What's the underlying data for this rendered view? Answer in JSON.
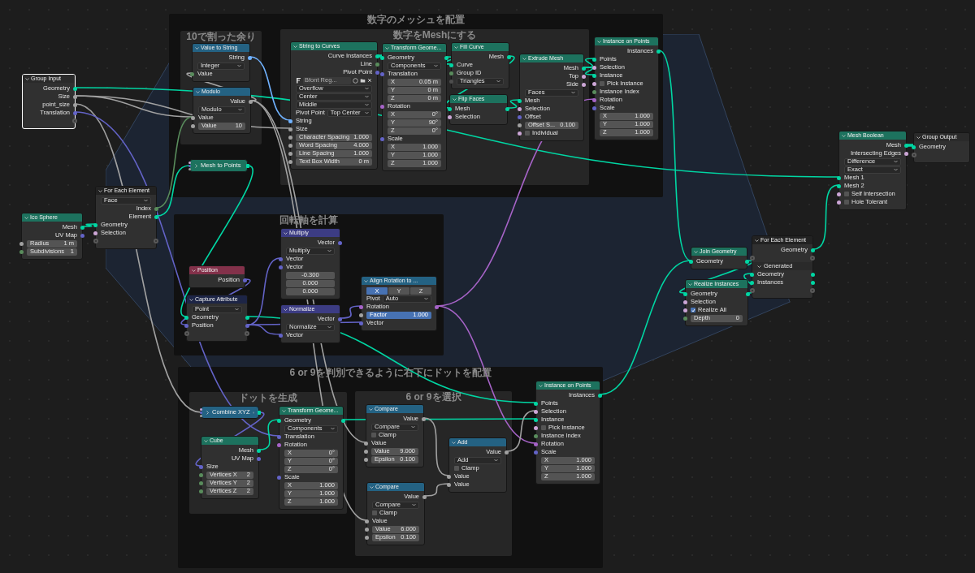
{
  "frames": [
    {
      "title": "数字のメッシュを配置",
      "color": "#111111"
    },
    {
      "title": "10で割った余り",
      "color": "#262626"
    },
    {
      "title": "数字をMeshにする",
      "color": "#262626"
    },
    {
      "title": "回転軸を計算",
      "color": "#111111"
    },
    {
      "title": "6 or 9を判別できるように右下にドットを配置",
      "color": "#111111"
    },
    {
      "title": "ドットを生成",
      "color": "#262626"
    },
    {
      "title": "6 or 9を選択",
      "color": "#262626"
    }
  ],
  "nodes": [
    {
      "title": "Group Input",
      "color": "#2a2a2a",
      "collapsed": false,
      "selected": true,
      "rows": [
        {
          "kind": "socket",
          "label": "Geometry",
          "out": {
            "color": "#00d6a3"
          }
        },
        {
          "kind": "socket",
          "label": "Size",
          "out": {
            "color": "#a1a1a1"
          }
        },
        {
          "kind": "socket",
          "label": "point_size",
          "out": {
            "color": "#a1a1a1"
          }
        },
        {
          "kind": "socket",
          "label": "Translation",
          "out": {
            "color": "#6363c7"
          }
        },
        {
          "kind": "socket",
          "out": {
            "color": "#5a5a5a",
            "hollow": true
          }
        }
      ]
    },
    {
      "title": "Value to String",
      "color": "#246283",
      "collapsed": false,
      "selected": false,
      "rows": [
        {
          "kind": "socket",
          "label": "String",
          "out": {
            "color": "#70b2ff"
          }
        },
        {
          "kind": "menu",
          "value": "Integer"
        },
        {
          "kind": "socket",
          "label": "Value",
          "in": {
            "color": "#598c5c"
          }
        }
      ]
    },
    {
      "title": "Modulo",
      "color": "#246283",
      "collapsed": false,
      "selected": false,
      "rows": [
        {
          "kind": "socket",
          "label": "Value",
          "out": {
            "color": "#a1a1a1"
          }
        },
        {
          "kind": "menu",
          "value": "Modulo"
        },
        {
          "kind": "socket",
          "label": "Value",
          "in": {
            "color": "#a1a1a1"
          }
        },
        {
          "kind": "field",
          "label": "Value",
          "value": "10",
          "in": {
            "color": "#a1a1a1"
          }
        }
      ]
    },
    {
      "title": "Mesh to Points",
      "color": "#1d725e",
      "collapsed": true,
      "selected": false
    },
    {
      "title": "For Each Element",
      "color": "#222222",
      "collapsed": false,
      "selected": false,
      "rows": [
        {
          "kind": "menu",
          "value": "Face"
        },
        {
          "kind": "socket",
          "label": "Index",
          "out": {
            "color": "#598c5c"
          }
        },
        {
          "kind": "socket",
          "label": "Element",
          "out": {
            "color": "#00d6a3"
          }
        },
        {
          "kind": "socket",
          "label": "Geometry",
          "in": {
            "color": "#00d6a3"
          }
        },
        {
          "kind": "socket",
          "label": "Selection",
          "in": {
            "color": "#cca6d6"
          }
        },
        {
          "kind": "socket",
          "in": {
            "color": "#5a5a5a",
            "hollow": true
          },
          "out": {
            "color": "#5a5a5a",
            "hollow": true
          }
        }
      ]
    },
    {
      "title": "Ico Sphere",
      "color": "#1d725e",
      "collapsed": false,
      "selected": false,
      "rows": [
        {
          "kind": "socket",
          "label": "Mesh",
          "out": {
            "color": "#00d6a3"
          }
        },
        {
          "kind": "socket",
          "label": "UV Map",
          "out": {
            "color": "#6363c7"
          }
        },
        {
          "kind": "field",
          "label": "Radius",
          "value": "1 m",
          "in": {
            "color": "#a1a1a1"
          }
        },
        {
          "kind": "field",
          "label": "Subdivisions",
          "value": "1",
          "in": {
            "color": "#598c5c"
          }
        }
      ]
    },
    {
      "title": "String to Curves",
      "color": "#1d725e",
      "collapsed": false,
      "selected": false,
      "rows": [
        {
          "kind": "socket",
          "label": "Curve Instances",
          "out": {
            "color": "#00d6a3"
          }
        },
        {
          "kind": "socket",
          "label": "Line",
          "out": {
            "color": "#598c5c"
          }
        },
        {
          "kind": "socket",
          "label": "Pivot Point",
          "out": {
            "color": "#6363c7"
          }
        },
        {
          "kind": "font",
          "value": "Bfont Reg..."
        },
        {
          "kind": "menu",
          "value": "Overflow"
        },
        {
          "kind": "menu",
          "value": "Center"
        },
        {
          "kind": "menu",
          "value": "Middle"
        },
        {
          "kind": "menu",
          "label": "Pivot Point",
          "value": "Top Center"
        },
        {
          "kind": "socket",
          "label": "String",
          "in": {
            "color": "#70b2ff"
          }
        },
        {
          "kind": "socket",
          "label": "Size",
          "in": {
            "color": "#a1a1a1"
          }
        },
        {
          "kind": "field",
          "label": "Character Spacing",
          "value": "1.000",
          "in": {
            "color": "#a1a1a1"
          }
        },
        {
          "kind": "field",
          "label": "Word Spacing",
          "value": "4.000",
          "in": {
            "color": "#a1a1a1"
          }
        },
        {
          "kind": "field",
          "label": "Line Spacing",
          "value": "1.000",
          "in": {
            "color": "#a1a1a1"
          }
        },
        {
          "kind": "field",
          "label": "Text Box Width",
          "value": "0 m",
          "in": {
            "color": "#a1a1a1"
          }
        }
      ]
    },
    {
      "title": "Transform Geome...",
      "color": "#1d725e",
      "collapsed": false,
      "selected": false,
      "rows": [
        {
          "kind": "socket",
          "label": "Geometry",
          "in": {
            "color": "#00d6a3"
          },
          "out": {
            "color": "#00d6a3"
          }
        },
        {
          "kind": "menu",
          "value": "Components"
        },
        {
          "kind": "socket",
          "label": "Translation",
          "in": {
            "color": "#6363c7"
          }
        },
        {
          "kind": "field",
          "label": "X",
          "value": "0.05 m"
        },
        {
          "kind": "field",
          "label": "Y",
          "value": "0 m"
        },
        {
          "kind": "field",
          "label": "Z",
          "value": "0 m"
        },
        {
          "kind": "socket",
          "label": "Rotation",
          "in": {
            "color": "#a663c7"
          }
        },
        {
          "kind": "field",
          "label": "X",
          "value": "0°"
        },
        {
          "kind": "field",
          "label": "Y",
          "value": "90°"
        },
        {
          "kind": "field",
          "label": "Z",
          "value": "0°"
        },
        {
          "kind": "socket",
          "label": "Scale",
          "in": {
            "color": "#6363c7"
          }
        },
        {
          "kind": "field",
          "label": "X",
          "value": "1.000"
        },
        {
          "kind": "field",
          "label": "Y",
          "value": "1.000"
        },
        {
          "kind": "field",
          "label": "Z",
          "value": "1.000"
        }
      ]
    },
    {
      "title": "Fill Curve",
      "color": "#1d725e",
      "collapsed": false,
      "selected": false,
      "rows": [
        {
          "kind": "socket",
          "label": "Mesh",
          "out": {
            "color": "#00d6a3"
          }
        },
        {
          "kind": "socket",
          "label": "Curve",
          "in": {
            "color": "#00d6a3"
          }
        },
        {
          "kind": "socket",
          "label": "Group ID",
          "in": {
            "color": "#598c5c"
          }
        },
        {
          "kind": "menu",
          "value": "Triangles",
          "in": {
            "color": "#4d4d4d"
          }
        }
      ]
    },
    {
      "title": "Flip Faces",
      "color": "#1d725e",
      "collapsed": false,
      "selected": false,
      "rows": [
        {
          "kind": "socket",
          "label": "Mesh",
          "in": {
            "color": "#00d6a3"
          },
          "out": {
            "color": "#00d6a3"
          }
        },
        {
          "kind": "socket",
          "label": "Selection",
          "in": {
            "color": "#cca6d6"
          }
        }
      ]
    },
    {
      "title": "Extrude Mesh",
      "color": "#1d725e",
      "collapsed": false,
      "selected": false,
      "rows": [
        {
          "kind": "socket",
          "label": "Mesh",
          "out": {
            "color": "#00d6a3"
          }
        },
        {
          "kind": "socket",
          "label": "Top",
          "out": {
            "color": "#cca6d6"
          }
        },
        {
          "kind": "socket",
          "label": "Side",
          "out": {
            "color": "#cca6d6"
          }
        },
        {
          "kind": "menu",
          "value": "Faces"
        },
        {
          "kind": "socket",
          "label": "Mesh",
          "in": {
            "color": "#00d6a3"
          }
        },
        {
          "kind": "socket",
          "label": "Selection",
          "in": {
            "color": "#cca6d6"
          }
        },
        {
          "kind": "socket",
          "label": "Offset",
          "in": {
            "color": "#6363c7"
          }
        },
        {
          "kind": "field",
          "label": "Offset S...",
          "value": "0.100",
          "in": {
            "color": "#a1a1a1"
          }
        },
        {
          "kind": "check",
          "label": "Individual",
          "checked": false,
          "in": {
            "color": "#cca6d6"
          }
        }
      ]
    },
    {
      "title": "Instance on Points",
      "color": "#1d725e",
      "collapsed": false,
      "selected": false,
      "rows": [
        {
          "kind": "socket",
          "label": "Instances",
          "out": {
            "color": "#00d6a3"
          }
        },
        {
          "kind": "socket",
          "label": "Points",
          "in": {
            "color": "#00d6a3"
          }
        },
        {
          "kind": "socket",
          "label": "Selection",
          "in": {
            "color": "#cca6d6"
          }
        },
        {
          "kind": "socket",
          "label": "Instance",
          "in": {
            "color": "#00d6a3"
          }
        },
        {
          "kind": "check",
          "label": "Pick Instance",
          "checked": false,
          "in": {
            "color": "#cca6d6"
          }
        },
        {
          "kind": "socket",
          "label": "Instance Index",
          "in": {
            "color": "#598c5c"
          }
        },
        {
          "kind": "socket",
          "label": "Rotation",
          "in": {
            "color": "#a663c7"
          }
        },
        {
          "kind": "socket",
          "label": "Scale",
          "in": {
            "color": "#6363c7"
          }
        },
        {
          "kind": "field",
          "label": "X",
          "value": "1.000"
        },
        {
          "kind": "field",
          "label": "Y",
          "value": "1.000"
        },
        {
          "kind": "field",
          "label": "Z",
          "value": "1.000"
        }
      ]
    },
    {
      "title": "Mesh Boolean",
      "color": "#1d725e",
      "collapsed": false,
      "selected": false,
      "rows": [
        {
          "kind": "socket",
          "label": "Mesh",
          "out": {
            "color": "#00d6a3"
          }
        },
        {
          "kind": "socket",
          "label": "Intersecting Edges",
          "out": {
            "color": "#cca6d6"
          }
        },
        {
          "kind": "menu",
          "value": "Difference"
        },
        {
          "kind": "menu",
          "value": "Exact"
        },
        {
          "kind": "socket",
          "label": "Mesh 1",
          "in": {
            "color": "#00d6a3"
          }
        },
        {
          "kind": "socket",
          "label": "Mesh 2",
          "in": {
            "color": "#00d6a3"
          }
        },
        {
          "kind": "check",
          "label": "Self Intersection",
          "checked": false,
          "in": {
            "color": "#cca6d6"
          }
        },
        {
          "kind": "check",
          "label": "Hole Tolerant",
          "checked": false,
          "in": {
            "color": "#cca6d6"
          }
        }
      ]
    },
    {
      "title": "Group Output",
      "color": "#2a2a2a",
      "collapsed": false,
      "selected": false,
      "rows": [
        {
          "kind": "socket",
          "label": "Geometry",
          "in": {
            "color": "#00d6a3"
          }
        },
        {
          "kind": "socket",
          "in": {
            "color": "#5a5a5a",
            "hollow": true
          }
        }
      ]
    },
    {
      "title": "Join Geometry",
      "color": "#1d725e",
      "collapsed": false,
      "selected": false,
      "rows": [
        {
          "kind": "socket",
          "label": "Geometry",
          "in": {
            "color": "#00d6a3"
          },
          "out": {
            "color": "#00d6a3"
          }
        }
      ]
    },
    {
      "title": "For Each Element",
      "color": "#222222",
      "collapsed": false,
      "selected": false,
      "rows": [
        {
          "kind": "socket",
          "label": "Geometry",
          "out": {
            "color": "#00d6a3"
          }
        },
        {
          "kind": "socket",
          "in": {
            "color": "#5a5a5a",
            "hollow": true
          },
          "out": {
            "color": "#5a5a5a",
            "hollow": true
          }
        },
        {
          "kind": "panel",
          "label": "Generated",
          "expanded": true
        },
        {
          "kind": "socket",
          "label": "Geometry",
          "in": {
            "color": "#00d6a3"
          },
          "out": {
            "color": "#00d6a3"
          }
        },
        {
          "kind": "socket",
          "label": "Instances",
          "in": {
            "color": "#00d6a3"
          },
          "out": {
            "color": "#00d6a3"
          }
        },
        {
          "kind": "socket",
          "in": {
            "color": "#5a5a5a",
            "hollow": true
          },
          "out": {
            "color": "#5a5a5a",
            "hollow": true
          }
        }
      ]
    },
    {
      "title": "Realize Instances",
      "color": "#1d725e",
      "collapsed": false,
      "selected": false,
      "rows": [
        {
          "kind": "socket",
          "label": "Geometry",
          "in": {
            "color": "#00d6a3"
          },
          "out": {
            "color": "#00d6a3"
          }
        },
        {
          "kind": "socket",
          "label": "Selection",
          "in": {
            "color": "#cca6d6"
          }
        },
        {
          "kind": "check",
          "label": "Realize All",
          "checked": true,
          "in": {
            "color": "#cca6d6"
          }
        },
        {
          "kind": "field",
          "label": "Depth",
          "value": "0",
          "in": {
            "color": "#598c5c"
          }
        }
      ]
    },
    {
      "title": "Position",
      "color": "#83314a",
      "collapsed": false,
      "selected": false,
      "rows": [
        {
          "kind": "socket",
          "label": "Position",
          "out": {
            "color": "#6363c7"
          }
        }
      ]
    },
    {
      "title": "Capture Attribute",
      "color": "#1d2546",
      "collapsed": false,
      "selected": false,
      "rows": [
        {
          "kind": "menu",
          "value": "Point"
        },
        {
          "kind": "socket",
          "label": "Geometry",
          "in": {
            "color": "#00d6a3"
          },
          "out": {
            "color": "#00d6a3"
          }
        },
        {
          "kind": "socket",
          "label": "Position",
          "in": {
            "color": "#6363c7"
          },
          "out": {
            "color": "#6363c7"
          }
        },
        {
          "kind": "socket",
          "in": {
            "color": "#5a5a5a",
            "hollow": true
          },
          "out": {
            "color": "#5a5a5a",
            "hollow": true
          }
        }
      ]
    },
    {
      "title": "Multiply",
      "color": "#3c3c83",
      "collapsed": false,
      "selected": false,
      "rows": [
        {
          "kind": "socket",
          "label": "Vector",
          "out": {
            "color": "#6363c7"
          }
        },
        {
          "kind": "menu",
          "value": "Multiply"
        },
        {
          "kind": "socket",
          "label": "Vector",
          "in": {
            "color": "#6363c7"
          }
        },
        {
          "kind": "socket",
          "label": "Vector",
          "in": {
            "color": "#6363c7"
          }
        },
        {
          "kind": "field",
          "value": "-0.300"
        },
        {
          "kind": "field",
          "value": "0.000"
        },
        {
          "kind": "field",
          "value": "0.000"
        }
      ]
    },
    {
      "title": "Normalize",
      "color": "#3c3c83",
      "collapsed": false,
      "selected": false,
      "rows": [
        {
          "kind": "socket",
          "label": "Vector",
          "out": {
            "color": "#6363c7"
          }
        },
        {
          "kind": "menu",
          "value": "Normalize"
        },
        {
          "kind": "socket",
          "label": "Vector",
          "in": {
            "color": "#6363c7"
          }
        }
      ]
    },
    {
      "title": "Align Rotation to ...",
      "color": "#246283",
      "collapsed": false,
      "selected": false,
      "rows": [
        {
          "kind": "axes",
          "items": [
            {
              "label": "X",
              "selected": true
            },
            {
              "label": "Y",
              "selected": false
            },
            {
              "label": "Z",
              "selected": false
            }
          ]
        },
        {
          "kind": "menu",
          "label": "Pivot",
          "value": "Auto"
        },
        {
          "kind": "socket",
          "label": "Rotation",
          "in": {
            "color": "#a663c7"
          },
          "out": {
            "color": "#a663c7"
          }
        },
        {
          "kind": "slider",
          "label": "Factor",
          "value": "1.000",
          "level": 1,
          "in": {
            "color": "#a1a1a1"
          }
        },
        {
          "kind": "socket",
          "label": "Vector",
          "in": {
            "color": "#6363c7"
          }
        }
      ]
    },
    {
      "title": "Combine XYZ",
      "color": "#246283",
      "collapsed": true,
      "selected": false
    },
    {
      "title": "Cube",
      "color": "#1d725e",
      "collapsed": false,
      "selected": false,
      "rows": [
        {
          "kind": "socket",
          "label": "Mesh",
          "out": {
            "color": "#00d6a3"
          }
        },
        {
          "kind": "socket",
          "label": "UV Map",
          "out": {
            "color": "#6363c7"
          }
        },
        {
          "kind": "socket",
          "label": "Size",
          "in": {
            "color": "#6363c7"
          }
        },
        {
          "kind": "field",
          "label": "Vertices X",
          "value": "2",
          "in": {
            "color": "#598c5c"
          }
        },
        {
          "kind": "field",
          "label": "Vertices Y",
          "value": "2",
          "in": {
            "color": "#598c5c"
          }
        },
        {
          "kind": "field",
          "label": "Vertices Z",
          "value": "2",
          "in": {
            "color": "#598c5c"
          }
        }
      ]
    },
    {
      "title": "Transform Geome...",
      "color": "#1d725e",
      "collapsed": false,
      "selected": false,
      "rows": [
        {
          "kind": "socket",
          "label": "Geometry",
          "in": {
            "color": "#00d6a3"
          },
          "out": {
            "color": "#00d6a3"
          }
        },
        {
          "kind": "menu",
          "value": "Components"
        },
        {
          "kind": "socket",
          "label": "Translation",
          "in": {
            "color": "#6363c7"
          }
        },
        {
          "kind": "socket",
          "label": "Rotation",
          "in": {
            "color": "#a663c7"
          }
        },
        {
          "kind": "field",
          "label": "X",
          "value": "0°"
        },
        {
          "kind": "field",
          "label": "Y",
          "value": "0°"
        },
        {
          "kind": "field",
          "label": "Z",
          "value": "0°"
        },
        {
          "kind": "socket",
          "label": "Scale",
          "in": {
            "color": "#6363c7"
          }
        },
        {
          "kind": "field",
          "label": "X",
          "value": "1.000"
        },
        {
          "kind": "field",
          "label": "Y",
          "value": "1.000"
        },
        {
          "kind": "field",
          "label": "Z",
          "value": "1.000"
        }
      ]
    },
    {
      "title": "Compare",
      "color": "#246283",
      "collapsed": false,
      "selected": false,
      "rows": [
        {
          "kind": "socket",
          "label": "Value",
          "out": {
            "color": "#a1a1a1"
          }
        },
        {
          "kind": "menu",
          "value": "Compare"
        },
        {
          "kind": "check",
          "label": "Clamp",
          "checked": false
        },
        {
          "kind": "socket",
          "label": "Value",
          "in": {
            "color": "#a1a1a1"
          }
        },
        {
          "kind": "field",
          "label": "Value",
          "value": "9.000",
          "in": {
            "color": "#a1a1a1"
          }
        },
        {
          "kind": "field",
          "label": "Epsilon",
          "value": "0.100",
          "in": {
            "color": "#a1a1a1"
          }
        }
      ]
    },
    {
      "title": "Compare",
      "color": "#246283",
      "collapsed": false,
      "selected": false,
      "rows": [
        {
          "kind": "socket",
          "label": "Value",
          "out": {
            "color": "#a1a1a1"
          }
        },
        {
          "kind": "menu",
          "value": "Compare"
        },
        {
          "kind": "check",
          "label": "Clamp",
          "checked": false
        },
        {
          "kind": "socket",
          "label": "Value",
          "in": {
            "color": "#a1a1a1"
          }
        },
        {
          "kind": "field",
          "label": "Value",
          "value": "6.000",
          "in": {
            "color": "#a1a1a1"
          }
        },
        {
          "kind": "field",
          "label": "Epsilon",
          "value": "0.100",
          "in": {
            "color": "#a1a1a1"
          }
        }
      ]
    },
    {
      "title": "Add",
      "color": "#246283",
      "collapsed": false,
      "selected": false,
      "rows": [
        {
          "kind": "socket",
          "label": "Value",
          "out": {
            "color": "#a1a1a1"
          }
        },
        {
          "kind": "menu",
          "value": "Add"
        },
        {
          "kind": "check",
          "label": "Clamp",
          "checked": false
        },
        {
          "kind": "socket",
          "label": "Value",
          "in": {
            "color": "#a1a1a1"
          }
        },
        {
          "kind": "socket",
          "label": "Value",
          "in": {
            "color": "#a1a1a1"
          }
        }
      ]
    },
    {
      "title": "Instance on Points",
      "color": "#1d725e",
      "collapsed": false,
      "selected": false,
      "rows": [
        {
          "kind": "socket",
          "label": "Instances",
          "out": {
            "color": "#00d6a3"
          }
        },
        {
          "kind": "socket",
          "label": "Points",
          "in": {
            "color": "#00d6a3"
          }
        },
        {
          "kind": "socket",
          "label": "Selection",
          "in": {
            "color": "#cca6d6"
          }
        },
        {
          "kind": "socket",
          "label": "Instance",
          "in": {
            "color": "#00d6a3"
          }
        },
        {
          "kind": "check",
          "label": "Pick Instance",
          "checked": false,
          "in": {
            "color": "#cca6d6"
          }
        },
        {
          "kind": "socket",
          "label": "Instance Index",
          "in": {
            "color": "#598c5c"
          }
        },
        {
          "kind": "socket",
          "label": "Rotation",
          "in": {
            "color": "#a663c7"
          }
        },
        {
          "kind": "socket",
          "label": "Scale",
          "in": {
            "color": "#6363c7"
          }
        },
        {
          "kind": "field",
          "label": "X",
          "value": "1.000"
        },
        {
          "kind": "field",
          "label": "Y",
          "value": "1.000"
        },
        {
          "kind": "field",
          "label": "Z",
          "value": "1.000"
        }
      ]
    }
  ]
}
